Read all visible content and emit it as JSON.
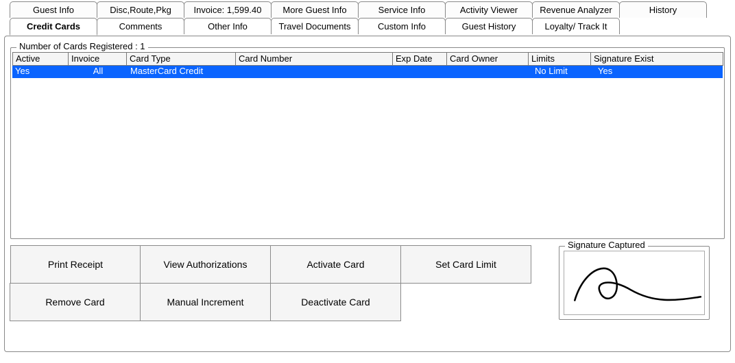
{
  "tabs_row1": [
    {
      "label": "Guest Info"
    },
    {
      "label": "Disc,Route,Pkg"
    },
    {
      "label": "Invoice: 1,599.40"
    },
    {
      "label": "More Guest Info"
    },
    {
      "label": "Service Info"
    },
    {
      "label": "Activity Viewer"
    },
    {
      "label": "Revenue Analyzer"
    },
    {
      "label": "History"
    }
  ],
  "tabs_row2": [
    {
      "label": "Credit Cards"
    },
    {
      "label": "Comments"
    },
    {
      "label": "Other Info"
    },
    {
      "label": "Travel Documents"
    },
    {
      "label": "Custom Info"
    },
    {
      "label": "Guest History"
    },
    {
      "label": "Loyalty/ Track It"
    }
  ],
  "fieldset_title": "Number of Cards Registered : 1",
  "grid": {
    "headers": [
      "Active",
      "Invoice",
      "Card Type",
      "Card Number",
      "Exp Date",
      "Card Owner",
      "Limits",
      "Signature Exist"
    ],
    "rows": [
      {
        "active": "Yes",
        "invoice": "All",
        "card_type": "MasterCard Credit",
        "card_number": "",
        "exp_date": "",
        "card_owner": "",
        "limits": "No Limit",
        "sig_exist": "Yes"
      }
    ]
  },
  "buttons": {
    "print_receipt": "Print Receipt",
    "view_auth": "View Authorizations",
    "activate": "Activate Card",
    "set_limit": "Set Card Limit",
    "remove": "Remove Card",
    "manual_inc": "Manual Increment",
    "deactivate": "Deactivate Card"
  },
  "signature_title": "Signature Captured"
}
